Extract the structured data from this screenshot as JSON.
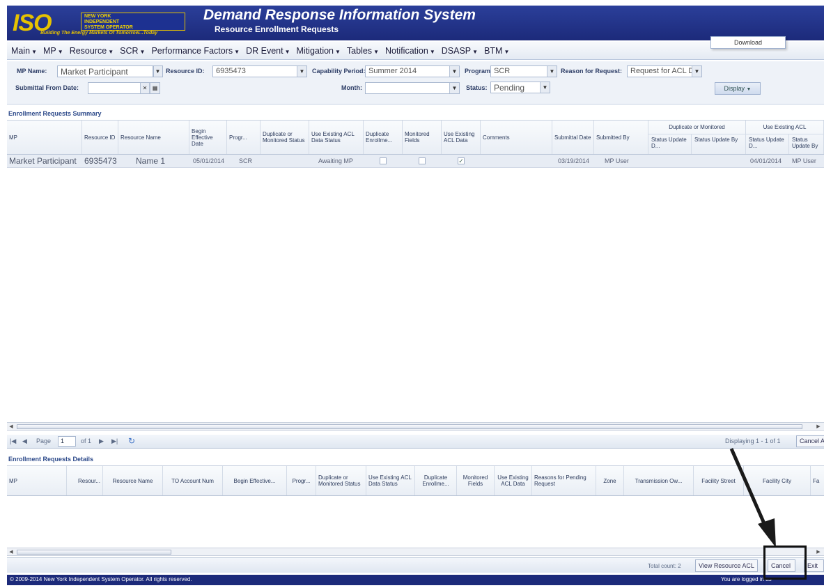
{
  "header": {
    "logo_text": "ISO",
    "logo_lines": [
      "NEW YORK",
      "INDEPENDENT",
      "SYSTEM OPERATOR"
    ],
    "logo_tagline": "Building The Energy Markets Of Tomorrow...Today",
    "title": "Demand Response Information System",
    "subtitle": "Resource Enrollment Requests"
  },
  "menu": [
    {
      "label": "Main"
    },
    {
      "label": "MP"
    },
    {
      "label": "Resource"
    },
    {
      "label": "SCR"
    },
    {
      "label": "Performance Factors"
    },
    {
      "label": "DR Event"
    },
    {
      "label": "Mitigation"
    },
    {
      "label": "Tables"
    },
    {
      "label": "Notification"
    },
    {
      "label": "DSASP"
    },
    {
      "label": "BTM"
    }
  ],
  "filters": {
    "mp_name_label": "MP Name:",
    "mp_name_value": "Market Participant",
    "resource_id_label": "Resource ID:",
    "resource_id_value": "6935473",
    "capability_period_label": "Capability Period:",
    "capability_period_value": "Summer 2014",
    "program_label": "Program:",
    "program_value": "SCR",
    "reason_label": "Reason for Request:",
    "reason_value": "Request for ACL Da",
    "submittal_from_label": "Submittal From Date:",
    "submittal_from_value": "",
    "month_label": "Month:",
    "month_value": "",
    "status_label": "Status:",
    "status_value": "Pending",
    "display_button": "Display",
    "download_item": "Download"
  },
  "summary": {
    "title": "Enrollment Requests Summary",
    "columns": [
      "MP",
      "Resource ID",
      "Resource Name",
      "Begin Effective Date",
      "Progr...",
      "Duplicate or Monitored Status",
      "Use Existing ACL Data Status",
      "Duplicate Enrollme...",
      "Monitored Fields",
      "Use Existing ACL Data",
      "Comments",
      "Submittal Date",
      "Submitted By"
    ],
    "group_headers": [
      "Duplicate or Monitored",
      "Use Existing ACL"
    ],
    "sub_columns": [
      "Status Update D...",
      "Status Update By",
      "Status Update D...",
      "Status Update By"
    ],
    "row": {
      "mp": "Market Participant",
      "resource_id": "6935473",
      "resource_name": "Name 1",
      "begin_date": "05/01/2014",
      "program": "SCR",
      "acl_status": "Awaiting MP",
      "duplicate_checked": false,
      "monitored_checked": false,
      "use_acl_checked": true,
      "submittal_date": "03/19/2014",
      "submitted_by": "MP User",
      "acl_update_date": "04/01/2014",
      "acl_update_by": "MP User"
    }
  },
  "pager": {
    "page_label": "Page",
    "page_value": "1",
    "of_label": "of 1",
    "displaying": "Displaying 1 - 1 of 1",
    "cancel_acl": "Cancel ACL"
  },
  "details": {
    "title": "Enrollment Requests Details",
    "columns": [
      "MP",
      "Resour...",
      "Resource Name",
      "TO Account Num",
      "Begin Effective...",
      "Progr...",
      "Duplicate or Monitored Status",
      "Use Existing ACL Data Status",
      "Duplicate Enrollme...",
      "Monitored Fields",
      "Use Existing ACL Data",
      "Reasons for Pending Request",
      "Zone",
      "Transmission Ow...",
      "Facility Street",
      "Facility City",
      "Fa"
    ]
  },
  "bottom": {
    "total_count": "Total count: 2",
    "view_resource_acl": "View Resource ACL",
    "cancel": "Cancel",
    "exit": "Exit"
  },
  "footer": {
    "copyright": "© 2009-2014 New York Independent System Operator. All rights reserved.",
    "logged_in": "You are logged in as"
  },
  "colors": {
    "header_bg": "#1c2a7a",
    "logo_gold": "#e6c200",
    "grid_header": "#e9eef5"
  }
}
